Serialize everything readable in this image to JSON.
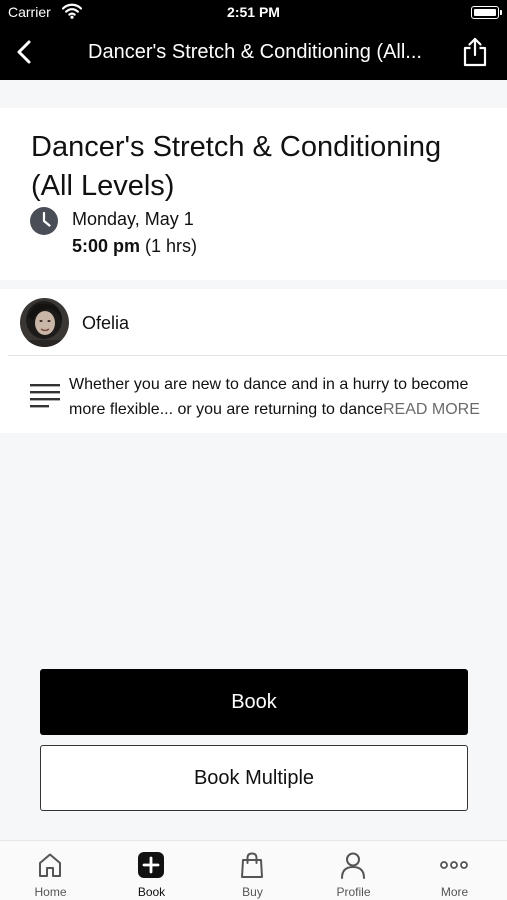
{
  "status_bar": {
    "carrier": "Carrier",
    "time": "2:51 PM"
  },
  "nav": {
    "title": "Dancer's Stretch & Conditioning (All...",
    "back_icon": "chevron-left-icon",
    "share_icon": "share-icon"
  },
  "class": {
    "title": "Dancer's Stretch & Conditioning (All Levels)",
    "date": "Monday, May 1",
    "time": "5:00 pm",
    "duration": " (1 hrs)"
  },
  "teacher": {
    "name": "Ofelia"
  },
  "description": {
    "text": "Whether you are new to dance and in a hurry to become more flexible...  or you are returning to dance",
    "read_more": "READ MORE"
  },
  "actions": {
    "book": "Book",
    "book_multiple": "Book Multiple"
  },
  "tabs": [
    {
      "label": "Home",
      "icon": "home-icon"
    },
    {
      "label": "Book",
      "icon": "plus-square-icon"
    },
    {
      "label": "Buy",
      "icon": "shopping-bag-icon"
    },
    {
      "label": "Profile",
      "icon": "person-icon"
    },
    {
      "label": "More",
      "icon": "more-dots-icon"
    }
  ],
  "colors": {
    "header_bg": "#000000",
    "page_bg": "#f6f7f9",
    "primary_button": "#000000",
    "clock_icon": "#4a4f57"
  }
}
